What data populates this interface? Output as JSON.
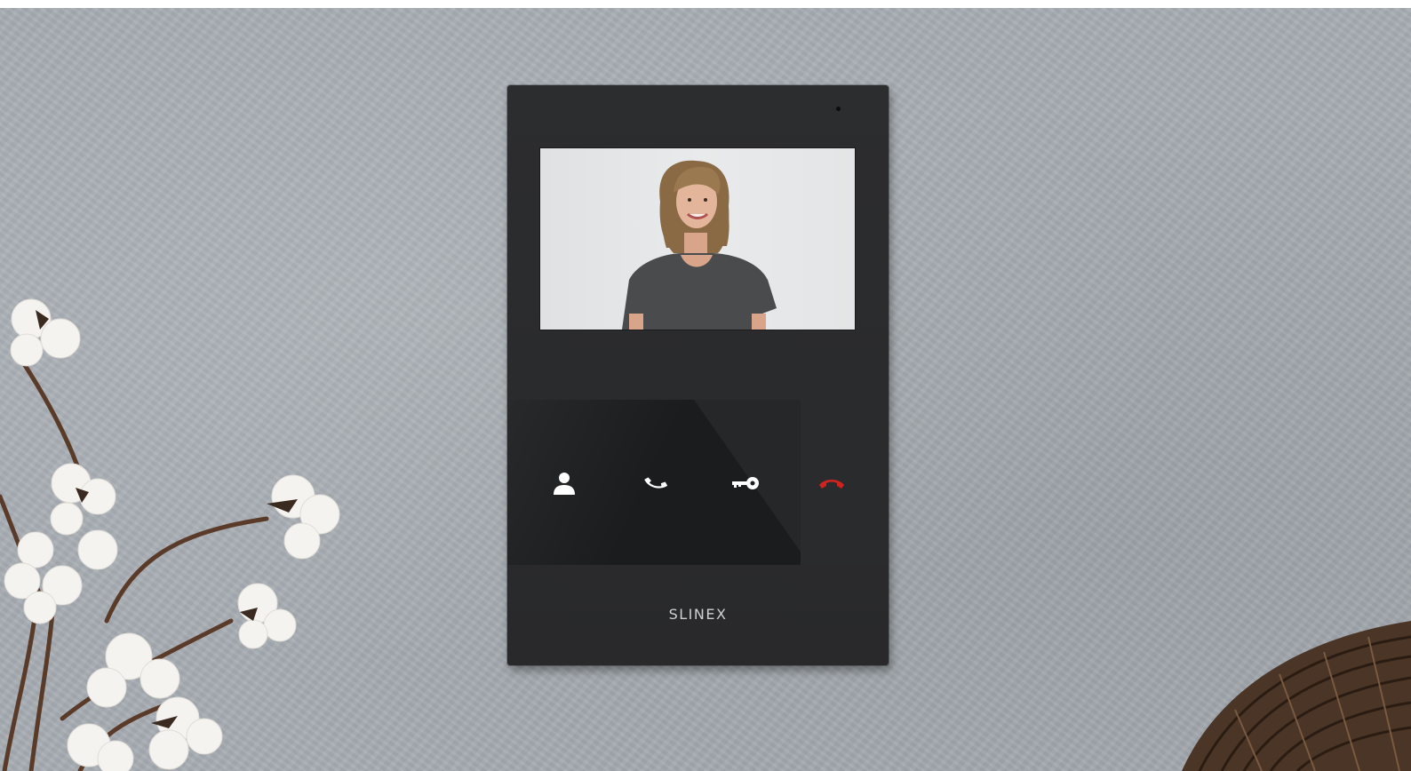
{
  "scene": {
    "wall_color": "#a7adb3",
    "device_color": "#2b2c2e"
  },
  "intercom": {
    "brand": "SLINEX",
    "buttons": [
      {
        "icon": "person-icon",
        "color": "#ffffff"
      },
      {
        "icon": "handset-answer-icon",
        "color": "#ffffff"
      },
      {
        "icon": "key-icon",
        "color": "#ffffff"
      },
      {
        "icon": "handset-hangup-icon",
        "color": "#d0231f"
      }
    ]
  }
}
